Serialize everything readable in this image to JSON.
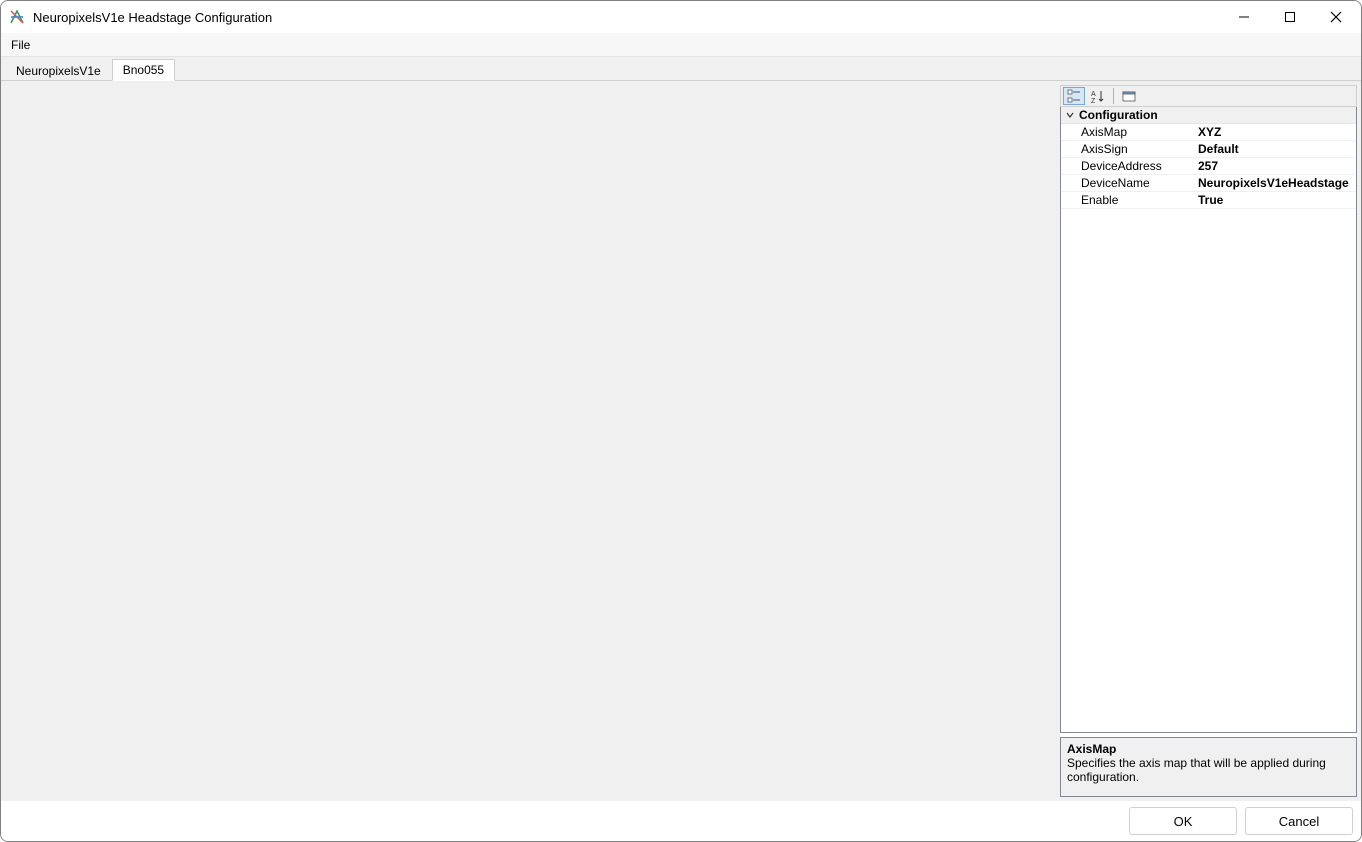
{
  "window": {
    "title": "NeuropixelsV1e Headstage Configuration"
  },
  "menubar": {
    "items": [
      "File"
    ]
  },
  "tabs": [
    {
      "label": "NeuropixelsV1e",
      "active": false
    },
    {
      "label": "Bno055",
      "active": true
    }
  ],
  "property_grid": {
    "group_label": "Configuration",
    "rows": [
      {
        "name": "AxisMap",
        "value": "XYZ",
        "selected": false
      },
      {
        "name": "AxisSign",
        "value": "Default",
        "selected": false
      },
      {
        "name": "DeviceAddress",
        "value": "257",
        "selected": false
      },
      {
        "name": "DeviceName",
        "value": "NeuropixelsV1eHeadstage",
        "selected": false
      },
      {
        "name": "Enable",
        "value": "True",
        "selected": false
      }
    ]
  },
  "description": {
    "title": "AxisMap",
    "text": "Specifies the axis map that will be applied during configuration."
  },
  "buttons": {
    "ok": "OK",
    "cancel": "Cancel"
  }
}
